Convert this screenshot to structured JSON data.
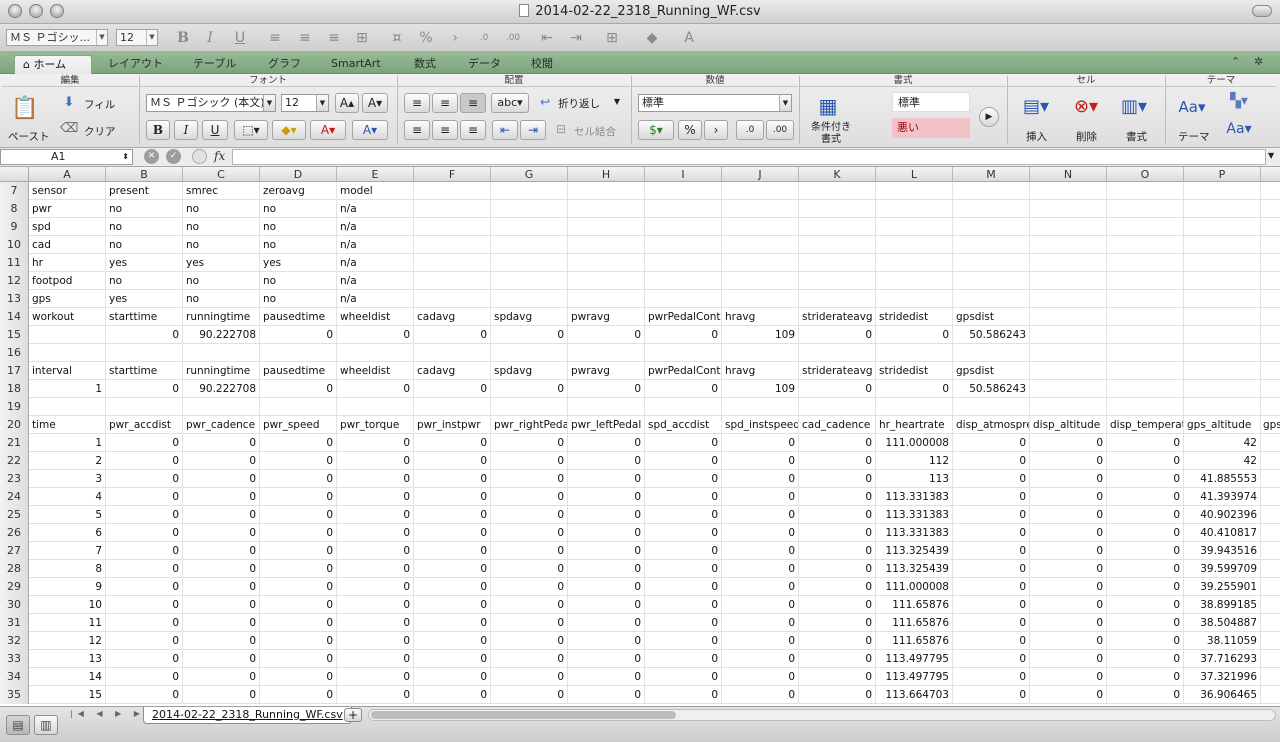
{
  "window": {
    "title": "2014-02-22_2318_Running_WF.csv"
  },
  "toolbar": {
    "font_name": "ＭＳ Ｐゴシッ...",
    "font_size": "12"
  },
  "tabs": [
    "ホーム",
    "レイアウト",
    "テーブル",
    "グラフ",
    "SmartArt",
    "数式",
    "データ",
    "校閲"
  ],
  "ribbon": {
    "groups": {
      "edit": "編集",
      "font": "フォント",
      "align": "配置",
      "number": "数値",
      "format": "書式",
      "cell": "セル",
      "theme": "テーマ"
    },
    "paste": "ペースト",
    "fill": "フィル",
    "clear": "クリア",
    "font_name": "ＭＳ Ｐゴシック (本文)",
    "font_size": "12",
    "wrap": "折り返し",
    "merge": "セル結合",
    "abc": "abc",
    "number_format": "標準",
    "conditional": "条件付き書式",
    "style_normal": "標準",
    "style_bad": "悪い",
    "insert": "挿入",
    "delete": "削除",
    "format": "書式",
    "theme": "テーマ"
  },
  "formula": {
    "namebox": "A1",
    "fx": "fx",
    "value": ""
  },
  "columns": [
    "A",
    "B",
    "C",
    "D",
    "E",
    "F",
    "G",
    "H",
    "I",
    "J",
    "K",
    "L",
    "M",
    "N",
    "O",
    "P"
  ],
  "rows": [
    {
      "n": "7",
      "cells": [
        "sensor",
        "present",
        "smrec",
        "zeroavg",
        "model",
        "",
        "",
        "",
        "",
        "",
        "",
        "",
        "",
        "",
        "",
        ""
      ]
    },
    {
      "n": "8",
      "cells": [
        "pwr",
        "no",
        "no",
        "no",
        "n/a",
        "",
        "",
        "",
        "",
        "",
        "",
        "",
        "",
        "",
        "",
        ""
      ]
    },
    {
      "n": "9",
      "cells": [
        "spd",
        "no",
        "no",
        "no",
        "n/a",
        "",
        "",
        "",
        "",
        "",
        "",
        "",
        "",
        "",
        "",
        ""
      ]
    },
    {
      "n": "10",
      "cells": [
        "cad",
        "no",
        "no",
        "no",
        "n/a",
        "",
        "",
        "",
        "",
        "",
        "",
        "",
        "",
        "",
        "",
        ""
      ]
    },
    {
      "n": "11",
      "cells": [
        "hr",
        "yes",
        "yes",
        "yes",
        "n/a",
        "",
        "",
        "",
        "",
        "",
        "",
        "",
        "",
        "",
        "",
        ""
      ]
    },
    {
      "n": "12",
      "cells": [
        "footpod",
        "no",
        "no",
        "no",
        "n/a",
        "",
        "",
        "",
        "",
        "",
        "",
        "",
        "",
        "",
        "",
        ""
      ]
    },
    {
      "n": "13",
      "cells": [
        "gps",
        "yes",
        "no",
        "no",
        "n/a",
        "",
        "",
        "",
        "",
        "",
        "",
        "",
        "",
        "",
        "",
        ""
      ]
    },
    {
      "n": "14",
      "cells": [
        "workout",
        "starttime",
        "runningtime",
        "pausedtime",
        "wheeldist",
        "cadavg",
        "spdavg",
        "pwravg",
        "pwrPedalContr",
        "hravg",
        "striderateavg",
        "stridedist",
        "gpsdist",
        "",
        "",
        ""
      ]
    },
    {
      "n": "15",
      "cells": [
        "",
        "0",
        "90.222708",
        "0",
        "0",
        "0",
        "0",
        "0",
        "0",
        "109",
        "0",
        "0",
        "50.586243",
        "",
        "",
        ""
      ]
    },
    {
      "n": "16",
      "cells": [
        "",
        "",
        "",
        "",
        "",
        "",
        "",
        "",
        "",
        "",
        "",
        "",
        "",
        "",
        "",
        ""
      ]
    },
    {
      "n": "17",
      "cells": [
        "interval",
        "starttime",
        "runningtime",
        "pausedtime",
        "wheeldist",
        "cadavg",
        "spdavg",
        "pwravg",
        "pwrPedalContr",
        "hravg",
        "striderateavg",
        "stridedist",
        "gpsdist",
        "",
        "",
        ""
      ]
    },
    {
      "n": "18",
      "cells": [
        "1",
        "0",
        "90.222708",
        "0",
        "0",
        "0",
        "0",
        "0",
        "0",
        "109",
        "0",
        "0",
        "50.586243",
        "",
        "",
        ""
      ]
    },
    {
      "n": "19",
      "cells": [
        "",
        "",
        "",
        "",
        "",
        "",
        "",
        "",
        "",
        "",
        "",
        "",
        "",
        "",
        "",
        ""
      ]
    },
    {
      "n": "20",
      "cells": [
        "time",
        "pwr_accdist",
        "pwr_cadence",
        "pwr_speed",
        "pwr_torque",
        "pwr_instpwr",
        "pwr_rightPedal",
        "pwr_leftPedal",
        "spd_accdist",
        "spd_instspeed",
        "cad_cadence",
        "hr_heartrate",
        "disp_atmospres",
        "disp_altitude",
        "disp_temperatu",
        "gps_altitude"
      ]
    },
    {
      "n": "21",
      "cells": [
        "1",
        "0",
        "0",
        "0",
        "0",
        "0",
        "0",
        "0",
        "0",
        "0",
        "0",
        "111.000008",
        "0",
        "0",
        "0",
        "42"
      ]
    },
    {
      "n": "22",
      "cells": [
        "2",
        "0",
        "0",
        "0",
        "0",
        "0",
        "0",
        "0",
        "0",
        "0",
        "0",
        "112",
        "0",
        "0",
        "0",
        "42"
      ]
    },
    {
      "n": "23",
      "cells": [
        "3",
        "0",
        "0",
        "0",
        "0",
        "0",
        "0",
        "0",
        "0",
        "0",
        "0",
        "113",
        "0",
        "0",
        "0",
        "41.885553"
      ]
    },
    {
      "n": "24",
      "cells": [
        "4",
        "0",
        "0",
        "0",
        "0",
        "0",
        "0",
        "0",
        "0",
        "0",
        "0",
        "113.331383",
        "0",
        "0",
        "0",
        "41.393974"
      ]
    },
    {
      "n": "25",
      "cells": [
        "5",
        "0",
        "0",
        "0",
        "0",
        "0",
        "0",
        "0",
        "0",
        "0",
        "0",
        "113.331383",
        "0",
        "0",
        "0",
        "40.902396"
      ]
    },
    {
      "n": "26",
      "cells": [
        "6",
        "0",
        "0",
        "0",
        "0",
        "0",
        "0",
        "0",
        "0",
        "0",
        "0",
        "113.331383",
        "0",
        "0",
        "0",
        "40.410817"
      ]
    },
    {
      "n": "27",
      "cells": [
        "7",
        "0",
        "0",
        "0",
        "0",
        "0",
        "0",
        "0",
        "0",
        "0",
        "0",
        "113.325439",
        "0",
        "0",
        "0",
        "39.943516"
      ]
    },
    {
      "n": "28",
      "cells": [
        "8",
        "0",
        "0",
        "0",
        "0",
        "0",
        "0",
        "0",
        "0",
        "0",
        "0",
        "113.325439",
        "0",
        "0",
        "0",
        "39.599709"
      ]
    },
    {
      "n": "29",
      "cells": [
        "9",
        "0",
        "0",
        "0",
        "0",
        "0",
        "0",
        "0",
        "0",
        "0",
        "0",
        "111.000008",
        "0",
        "0",
        "0",
        "39.255901"
      ]
    },
    {
      "n": "30",
      "cells": [
        "10",
        "0",
        "0",
        "0",
        "0",
        "0",
        "0",
        "0",
        "0",
        "0",
        "0",
        "111.65876",
        "0",
        "0",
        "0",
        "38.899185"
      ]
    },
    {
      "n": "31",
      "cells": [
        "11",
        "0",
        "0",
        "0",
        "0",
        "0",
        "0",
        "0",
        "0",
        "0",
        "0",
        "111.65876",
        "0",
        "0",
        "0",
        "38.504887"
      ]
    },
    {
      "n": "32",
      "cells": [
        "12",
        "0",
        "0",
        "0",
        "0",
        "0",
        "0",
        "0",
        "0",
        "0",
        "0",
        "111.65876",
        "0",
        "0",
        "0",
        "38.11059"
      ]
    },
    {
      "n": "33",
      "cells": [
        "13",
        "0",
        "0",
        "0",
        "0",
        "0",
        "0",
        "0",
        "0",
        "0",
        "0",
        "113.497795",
        "0",
        "0",
        "0",
        "37.716293"
      ]
    },
    {
      "n": "34",
      "cells": [
        "14",
        "0",
        "0",
        "0",
        "0",
        "0",
        "0",
        "0",
        "0",
        "0",
        "0",
        "113.497795",
        "0",
        "0",
        "0",
        "37.321996"
      ]
    },
    {
      "n": "35",
      "cells": [
        "15",
        "0",
        "0",
        "0",
        "0",
        "0",
        "0",
        "0",
        "0",
        "0",
        "0",
        "113.664703",
        "0",
        "0",
        "0",
        "36.906465"
      ]
    }
  ],
  "overflow_text": "gps",
  "sheet_tab": "2014-02-22_2318_Running_WF.csv",
  "add_sheet": "+",
  "colors": {
    "tab_bar": "#8db08d",
    "style_bad_bg": "#f2c2c8",
    "style_bad_text": "#9c0006"
  }
}
